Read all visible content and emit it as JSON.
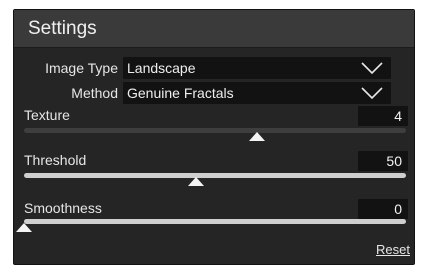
{
  "panel": {
    "title": "Settings"
  },
  "image_type": {
    "label": "Image Type",
    "value": "Landscape"
  },
  "method": {
    "label": "Method",
    "value": "Genuine Fractals"
  },
  "texture": {
    "label": "Texture",
    "value": "4",
    "level": 0.61
  },
  "threshold": {
    "label": "Threshold",
    "value": "50",
    "level": 0.45
  },
  "smoothness": {
    "label": "Smoothness",
    "value": "0",
    "level": 0.0
  },
  "reset_label": "Reset",
  "colors": {
    "panel_bg": "#252525",
    "header_bg": "#3a3a3a",
    "field_bg": "#121212",
    "text": "#eaeaea"
  }
}
